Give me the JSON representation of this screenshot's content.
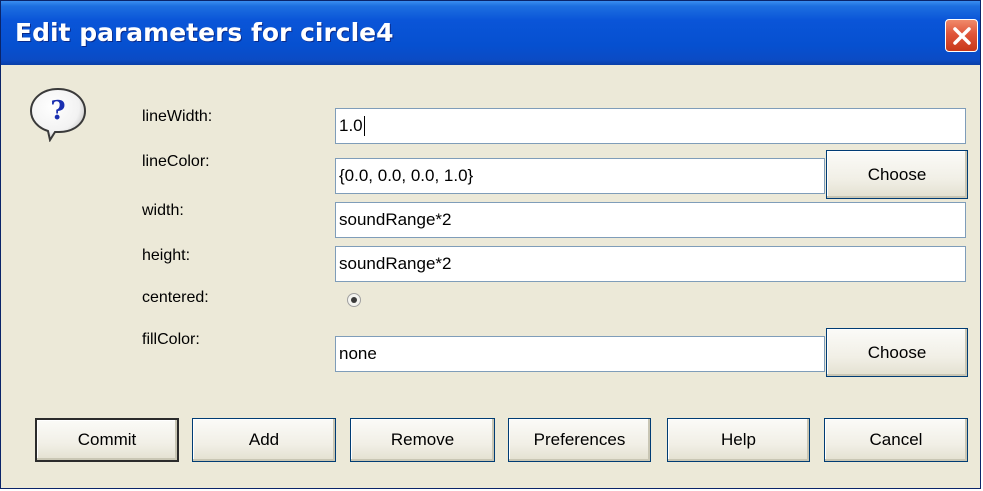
{
  "window": {
    "title": "Edit parameters for circle4",
    "close_icon": "close-icon",
    "help_icon": "question-balloon-icon"
  },
  "params": {
    "lineWidth": {
      "label": "lineWidth:",
      "value": "1.0"
    },
    "lineColor": {
      "label": "lineColor:",
      "value": "{0.0, 0.0, 0.0, 1.0}",
      "choose_label": "Choose"
    },
    "width": {
      "label": "width:",
      "value": "soundRange*2"
    },
    "height": {
      "label": "height:",
      "value": "soundRange*2"
    },
    "centered": {
      "label": "centered:",
      "checked": true
    },
    "fillColor": {
      "label": "fillColor:",
      "value": "none",
      "choose_label": "Choose"
    }
  },
  "actions": {
    "commit": "Commit",
    "add": "Add",
    "remove": "Remove",
    "preferences": "Preferences",
    "help": "Help",
    "cancel": "Cancel"
  },
  "colors": {
    "titlebar": "#0a55d8",
    "dialog_bg": "#ece9d8",
    "close_button": "#e0553a"
  }
}
